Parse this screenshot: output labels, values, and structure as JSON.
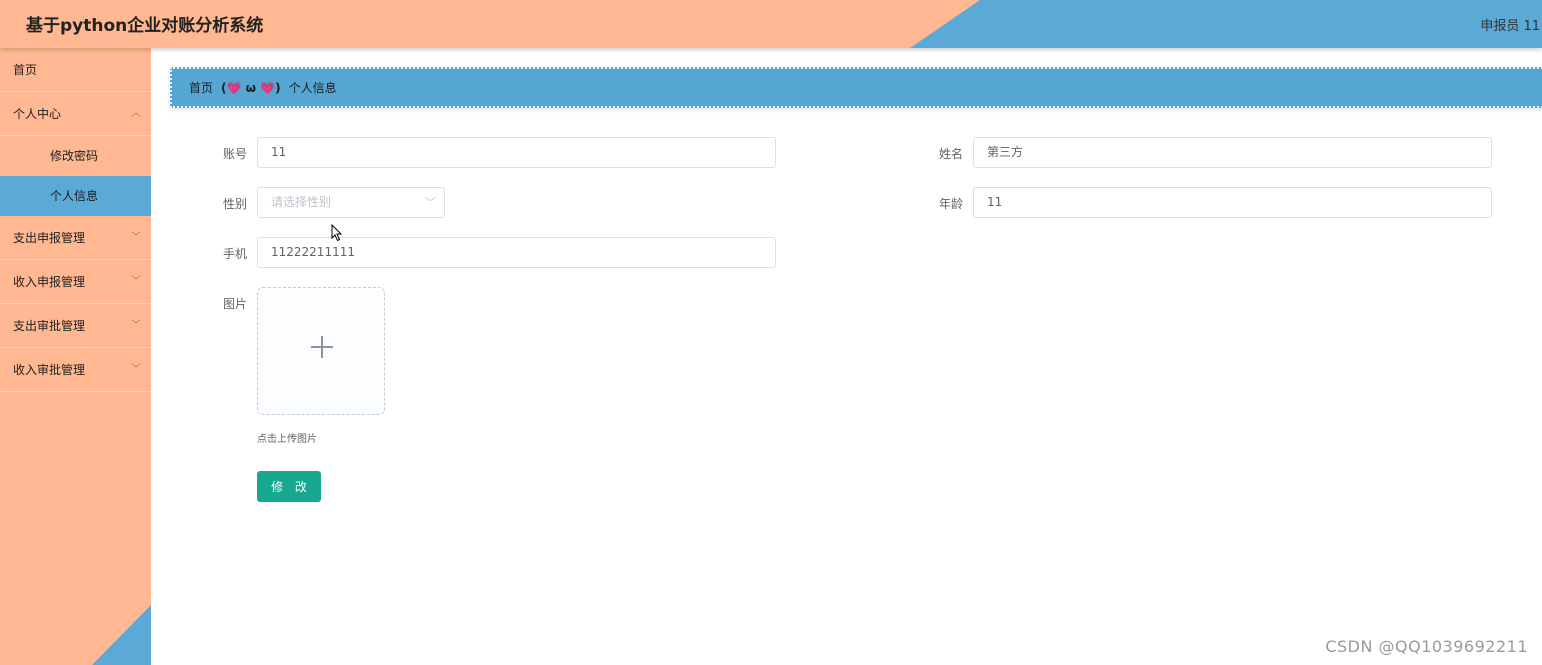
{
  "header": {
    "title": "基于python企业对账分析系统",
    "user": "申报员 11"
  },
  "sidebar": {
    "items": [
      {
        "label": "首页"
      },
      {
        "label": "个人中心",
        "expanded": true,
        "children": [
          {
            "label": "修改密码",
            "active": false
          },
          {
            "label": "个人信息",
            "active": true
          }
        ]
      },
      {
        "label": "支出申报管理"
      },
      {
        "label": "收入申报管理"
      },
      {
        "label": "支出审批管理"
      },
      {
        "label": "收入审批管理"
      }
    ]
  },
  "breadcrumb": {
    "home": "首页",
    "separator": "(💗 ω 💗)",
    "current": "个人信息"
  },
  "form": {
    "account": {
      "label": "账号",
      "value": "11"
    },
    "name": {
      "label": "姓名",
      "value": "第三方"
    },
    "gender": {
      "label": "性别",
      "placeholder": "请选择性别",
      "value": ""
    },
    "age": {
      "label": "年龄",
      "value": "11"
    },
    "phone": {
      "label": "手机",
      "value": "11222211111"
    },
    "image": {
      "label": "图片",
      "tip": "点击上传图片"
    },
    "submit_label": "修 改"
  },
  "watermark": "CSDN @QQ1039692211",
  "colors": {
    "peach": "#ffb891",
    "blue": "#5aa9d6",
    "submit": "#16a98f"
  }
}
